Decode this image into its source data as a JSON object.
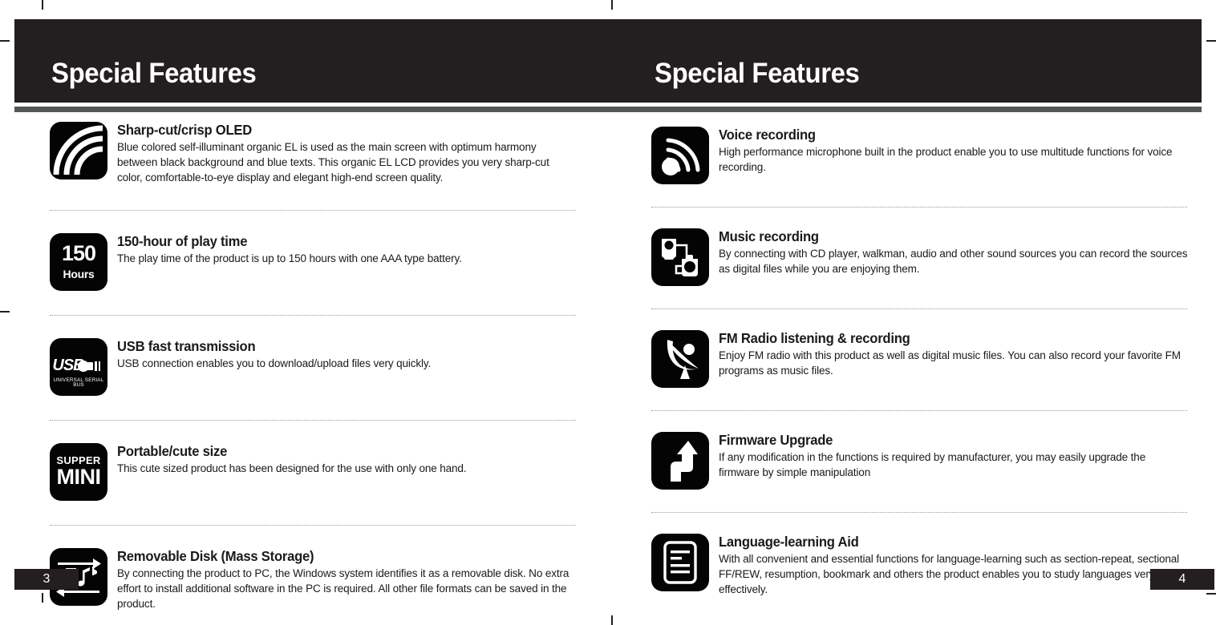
{
  "document": {
    "spread_title": "Special Features",
    "left_page": {
      "title": "Special Features",
      "page_number": "3",
      "features": [
        {
          "icon": "oled-arcs-icon",
          "title": "Sharp-cut/crisp OLED",
          "desc": "Blue colored self-illuminant organic EL is used as the main screen with optimum harmony between black background and blue texts. This organic EL LCD provides you very sharp-cut color, comfortable-to-eye display and elegant high-end screen quality."
        },
        {
          "icon": "battery-150-hours-icon",
          "icon_text_primary": "150",
          "icon_text_secondary": "Hours",
          "title": "150-hour of play time",
          "desc": "The play time of the product is up to 150 hours with one AAA type battery."
        },
        {
          "icon": "usb-logo-icon",
          "icon_text_primary": "USB",
          "icon_text_secondary": "UNIVERSAL SERIAL BUS",
          "title": "USB fast transmission",
          "desc": "USB connection enables you to download/upload files very quickly."
        },
        {
          "icon": "supper-mini-icon",
          "icon_text_primary": "SUPPER",
          "icon_text_secondary": "MINI",
          "title": "Portable/cute size",
          "desc": "This cute sized product has been designed for the use with only one hand."
        },
        {
          "icon": "music-transfer-icon",
          "title": "Removable Disk (Mass Storage)",
          "desc": "By connecting the product to PC, the Windows system identifies it as a removable disk. No extra effort to install additional software in the PC is required. All other file formats can be saved in the product."
        }
      ]
    },
    "right_page": {
      "title": "Special Features",
      "page_number": "4",
      "features": [
        {
          "icon": "microphone-waves-icon",
          "title": "Voice recording",
          "desc": "High performance microphone built in the product enable you to use multitude functions for voice recording."
        },
        {
          "icon": "device-cable-icon",
          "title": "Music recording",
          "desc": "By connecting with CD player, walkman, audio and other sound sources you can record the sources as digital files while you are enjoying them."
        },
        {
          "icon": "satellite-dish-icon",
          "title": "FM Radio listening & recording",
          "desc": "Enjoy FM radio with this product as well as digital music files. You can also record your favorite FM programs as music files."
        },
        {
          "icon": "upgrade-arrow-icon",
          "title": "Firmware Upgrade",
          "desc": "If any modification in the functions is required by manufacturer, you may easily upgrade the firmware by simple manipulation"
        },
        {
          "icon": "document-lines-icon",
          "title": "Language-learning Aid",
          "desc": "With all convenient and essential functions for language-learning such as section-repeat, sectional FF/REW, resumption, bookmark and others the product enables you to study languages very effectively."
        }
      ]
    }
  },
  "colors": {
    "header_black": "#231f20",
    "header_rule_gray": "#54565a",
    "icon_black": "#040404",
    "text_black": "#1a1a1a",
    "page_white": "#ffffff",
    "separator_gray": "#9a9a9a"
  }
}
